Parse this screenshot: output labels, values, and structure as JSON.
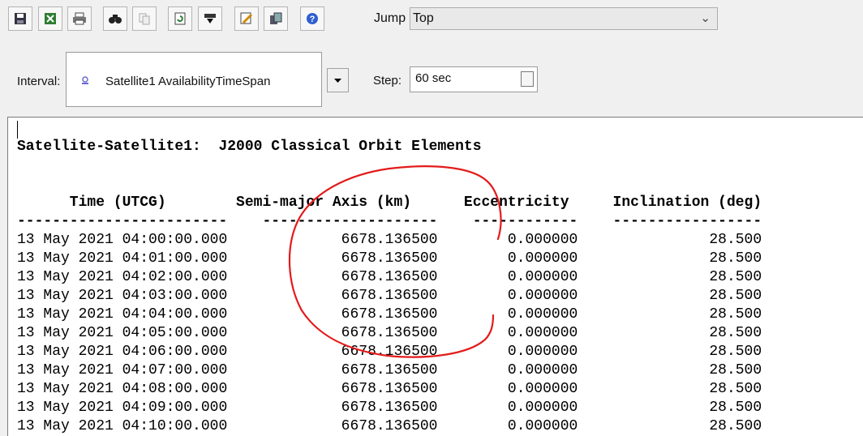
{
  "toolbar": {
    "buttons": [
      {
        "icon": "save-icon"
      },
      {
        "icon": "export-excel-icon"
      },
      {
        "icon": "print-icon"
      },
      {
        "icon": "find-icon"
      },
      {
        "icon": "copy-icon"
      },
      {
        "icon": "refresh-icon"
      },
      {
        "icon": "download-icon"
      },
      {
        "icon": "edit-icon"
      },
      {
        "icon": "windows-icon"
      },
      {
        "icon": "help-icon"
      }
    ],
    "jump_label": "Jump",
    "jump_value": "Top"
  },
  "interval": {
    "label": "Interval:",
    "value": "Satellite1  AvailabilityTimeSpan"
  },
  "step": {
    "label": "Step:",
    "value": "60 sec"
  },
  "report": {
    "title": "Satellite-Satellite1:  J2000 Classical Orbit Elements",
    "columns": [
      "Time (UTCG)",
      "Semi-major Axis (km)",
      "Eccentricity",
      "Inclination (deg)"
    ],
    "rows": [
      [
        "13 May 2021 04:00:00.000",
        "6678.136500",
        "0.000000",
        "28.500"
      ],
      [
        "13 May 2021 04:01:00.000",
        "6678.136500",
        "0.000000",
        "28.500"
      ],
      [
        "13 May 2021 04:02:00.000",
        "6678.136500",
        "0.000000",
        "28.500"
      ],
      [
        "13 May 2021 04:03:00.000",
        "6678.136500",
        "0.000000",
        "28.500"
      ],
      [
        "13 May 2021 04:04:00.000",
        "6678.136500",
        "0.000000",
        "28.500"
      ],
      [
        "13 May 2021 04:05:00.000",
        "6678.136500",
        "0.000000",
        "28.500"
      ],
      [
        "13 May 2021 04:06:00.000",
        "6678.136500",
        "0.000000",
        "28.500"
      ],
      [
        "13 May 2021 04:07:00.000",
        "6678.136500",
        "0.000000",
        "28.500"
      ],
      [
        "13 May 2021 04:08:00.000",
        "6678.136500",
        "0.000000",
        "28.500"
      ],
      [
        "13 May 2021 04:09:00.000",
        "6678.136500",
        "0.000000",
        "28.500"
      ],
      [
        "13 May 2021 04:10:00.000",
        "6678.136500",
        "0.000000",
        "28.500"
      ]
    ]
  },
  "colors": {
    "annotation": "#e31b1b"
  }
}
